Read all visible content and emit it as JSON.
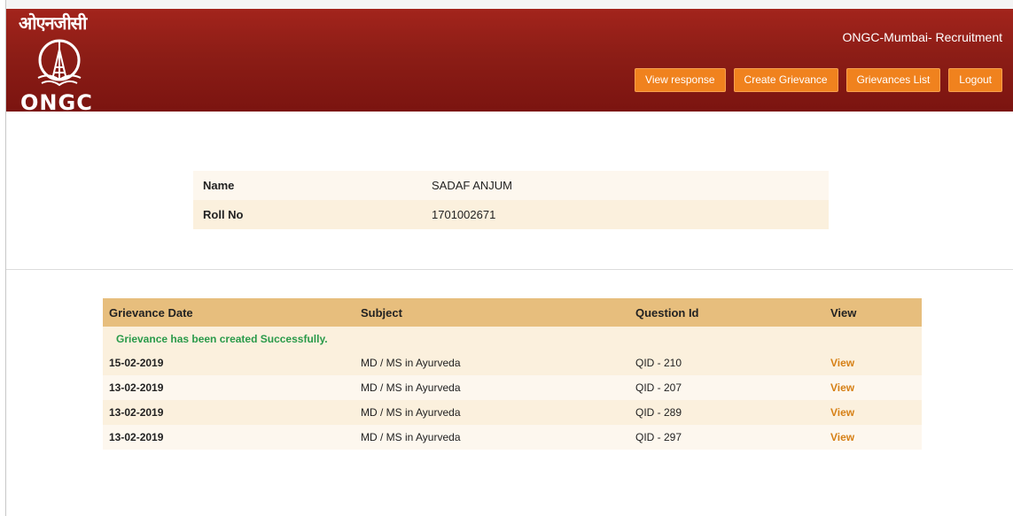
{
  "header": {
    "logo_hindi": "ओएनजीसी",
    "logo_text": "ONGC",
    "app_title": "ONGC-Mumbai- Recruitment",
    "nav": [
      {
        "label": "View response"
      },
      {
        "label": "Create Grievance"
      },
      {
        "label": "Grievances List"
      },
      {
        "label": "Logout"
      }
    ]
  },
  "candidate": {
    "name_label": "Name",
    "name_value": "SADAF ANJUM",
    "roll_label": "Roll No",
    "roll_value": "1701002671"
  },
  "grievances": {
    "columns": [
      "Grievance Date",
      "Subject",
      "Question Id",
      "View"
    ],
    "message": "Grievance has been created Successfully.",
    "rows": [
      {
        "date": "15-02-2019",
        "subject": "MD / MS in Ayurveda",
        "qid": "QID - 210",
        "view": "View"
      },
      {
        "date": "13-02-2019",
        "subject": "MD / MS in Ayurveda",
        "qid": "QID - 207",
        "view": "View"
      },
      {
        "date": "13-02-2019",
        "subject": "MD / MS in Ayurveda",
        "qid": "QID - 289",
        "view": "View"
      },
      {
        "date": "13-02-2019",
        "subject": "MD / MS in Ayurveda",
        "qid": "QID - 297",
        "view": "View"
      }
    ]
  },
  "colors": {
    "header": "#8c1d16",
    "nav_button": "#f0821e",
    "table_header": "#e7be7d",
    "success": "#2a9a4a",
    "link": "#d68016"
  }
}
